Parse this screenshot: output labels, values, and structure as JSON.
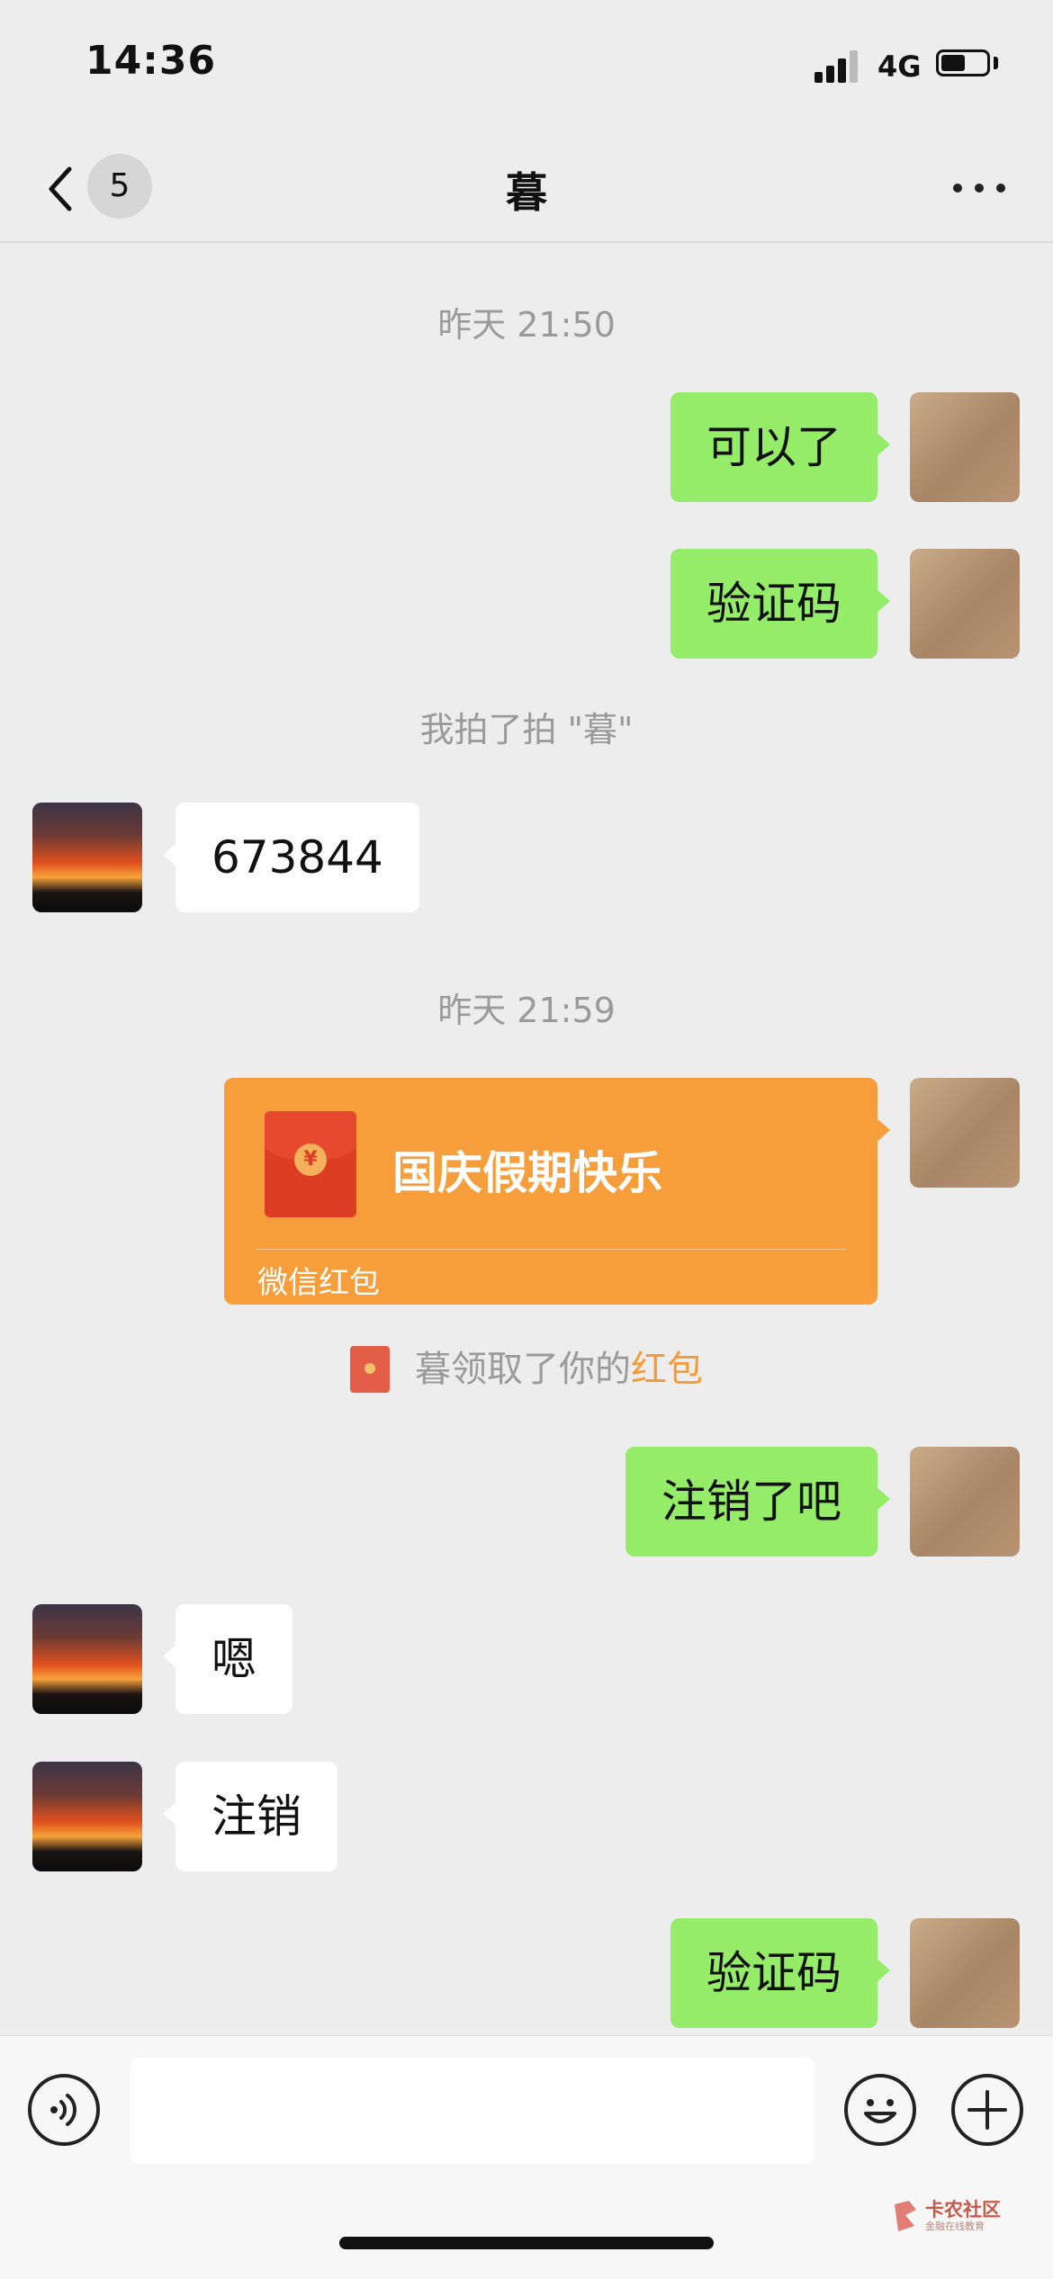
{
  "status_bar": {
    "time": "14:36",
    "network": "4G",
    "battery_level": 0.55
  },
  "nav": {
    "back_count": "5",
    "title": "暮",
    "back_icon": "chevron-left-icon",
    "more_icon": "ellipsis-icon"
  },
  "messages": [
    {
      "type": "timestamp",
      "text": "昨天 21:50"
    },
    {
      "type": "text",
      "sender": "self",
      "text": "可以了"
    },
    {
      "type": "text",
      "sender": "self",
      "text": "验证码"
    },
    {
      "type": "system",
      "text": "我拍了拍 \"暮\""
    },
    {
      "type": "text",
      "sender": "other",
      "text": "673844"
    },
    {
      "type": "timestamp",
      "text": "昨天 21:59"
    },
    {
      "type": "red_packet",
      "sender": "self",
      "greeting": "国庆假期快乐",
      "label": "微信红包",
      "seal": "¥"
    },
    {
      "type": "system_claim",
      "text": "暮领取了你的",
      "link": "红包"
    },
    {
      "type": "text",
      "sender": "self",
      "text": "注销了吧"
    },
    {
      "type": "text",
      "sender": "other",
      "text": "嗯"
    },
    {
      "type": "text",
      "sender": "other",
      "text": "注销"
    },
    {
      "type": "text",
      "sender": "self",
      "text": "验证码"
    }
  ],
  "input_bar": {
    "text_value": "",
    "voice_icon": "voice-icon",
    "emoji_icon": "emoji-icon",
    "plus_icon": "plus-icon"
  },
  "watermark": {
    "title": "卡农社区",
    "subtitle": "金融在线教育"
  },
  "colors": {
    "self_bubble": "#95ec69",
    "other_bubble": "#ffffff",
    "red_packet": "#f79e3c",
    "link": "#f59a34",
    "background": "#ededed"
  }
}
